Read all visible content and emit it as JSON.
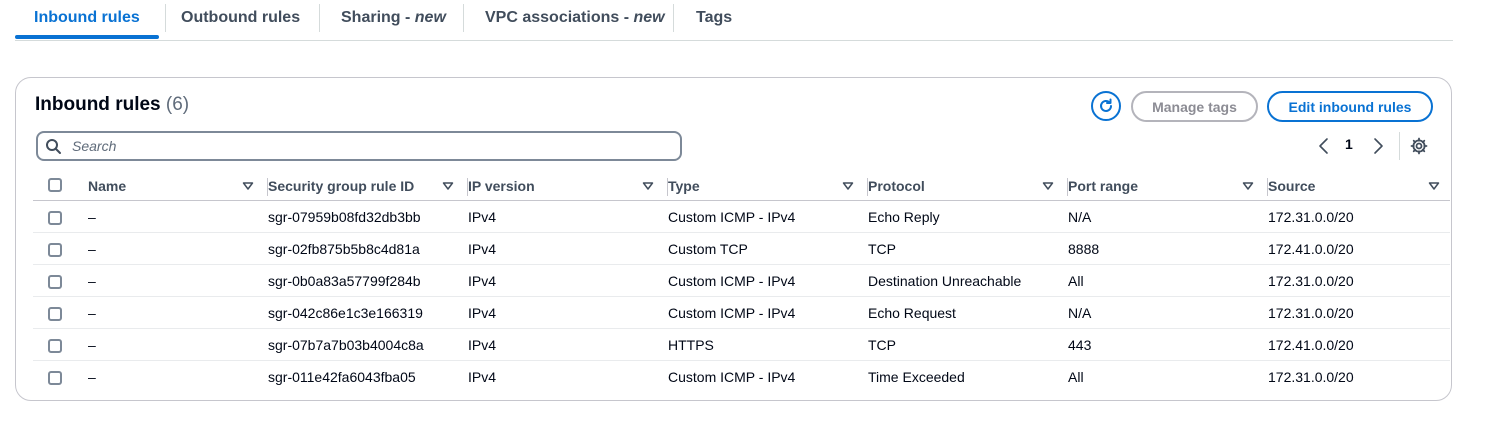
{
  "tabs": [
    {
      "label": "Inbound rules",
      "suffix": "",
      "active": true
    },
    {
      "label": "Outbound rules",
      "suffix": "",
      "active": false
    },
    {
      "label": "Sharing - ",
      "suffix": "new",
      "active": false
    },
    {
      "label": "VPC associations - ",
      "suffix": "new",
      "active": false
    },
    {
      "label": "Tags",
      "suffix": "",
      "active": false
    }
  ],
  "panel": {
    "title": "Inbound rules",
    "count": "(6)",
    "manage_tags_label": "Manage tags",
    "edit_rules_label": "Edit inbound rules",
    "refresh_icon": "refresh-icon",
    "settings_icon": "gear-icon"
  },
  "search": {
    "placeholder": "Search",
    "value": ""
  },
  "pagination": {
    "current_page": "1"
  },
  "table": {
    "columns": [
      "Name",
      "Security group rule ID",
      "IP version",
      "Type",
      "Protocol",
      "Port range",
      "Source"
    ],
    "rows": [
      {
        "name": "–",
        "rule_id": "sgr-07959b08fd32db3bb",
        "ip_version": "IPv4",
        "type": "Custom ICMP - IPv4",
        "protocol": "Echo Reply",
        "port_range": "N/A",
        "source": "172.31.0.0/20"
      },
      {
        "name": "–",
        "rule_id": "sgr-02fb875b5b8c4d81a",
        "ip_version": "IPv4",
        "type": "Custom TCP",
        "protocol": "TCP",
        "port_range": "8888",
        "source": "172.41.0.0/20"
      },
      {
        "name": "–",
        "rule_id": "sgr-0b0a83a57799f284b",
        "ip_version": "IPv4",
        "type": "Custom ICMP - IPv4",
        "protocol": "Destination Unreachable",
        "port_range": "All",
        "source": "172.31.0.0/20"
      },
      {
        "name": "–",
        "rule_id": "sgr-042c86e1c3e166319",
        "ip_version": "IPv4",
        "type": "Custom ICMP - IPv4",
        "protocol": "Echo Request",
        "port_range": "N/A",
        "source": "172.31.0.0/20"
      },
      {
        "name": "–",
        "rule_id": "sgr-07b7a7b03b4004c8a",
        "ip_version": "IPv4",
        "type": "HTTPS",
        "protocol": "TCP",
        "port_range": "443",
        "source": "172.41.0.0/20"
      },
      {
        "name": "–",
        "rule_id": "sgr-011e42fa6043fba05",
        "ip_version": "IPv4",
        "type": "Custom ICMP - IPv4",
        "protocol": "Time Exceeded",
        "port_range": "All",
        "source": "172.31.0.0/20"
      }
    ]
  },
  "colors": {
    "accent": "#0972d3",
    "text": "#000716",
    "muted": "#5f6b7a",
    "disabled": "#8c8c94"
  }
}
